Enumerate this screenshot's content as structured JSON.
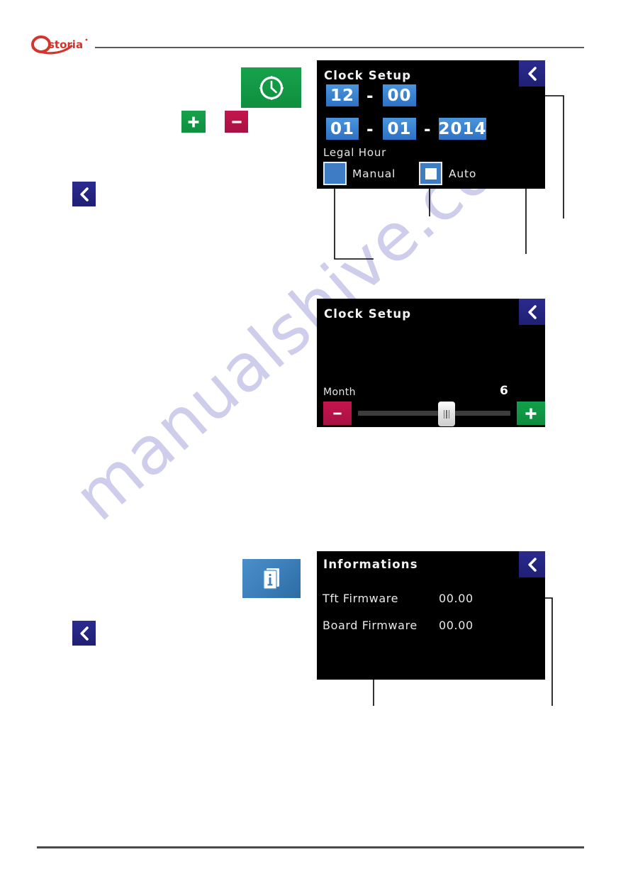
{
  "page": {
    "brand": "astoria",
    "watermark": "manualshive.com"
  },
  "icons": {
    "clock_button": "clock-icon",
    "plus_button": "plus-icon",
    "minus_button": "minus-icon",
    "info_button": "info-document-icon",
    "back_button": "chevron-left-icon"
  },
  "standalone_buttons": {
    "plus_label": "+",
    "minus_label": "-",
    "nav_back_upper": "<",
    "nav_back_lower": "<"
  },
  "panels": [
    {
      "id": "clock-setup-datetime",
      "title": "Clock Setup",
      "back_label": "<",
      "time": {
        "hours": "12",
        "minutes": "00",
        "separator": "-"
      },
      "date": {
        "day": "01",
        "month": "01",
        "year": "2014",
        "separator": "-"
      },
      "legal_hour": {
        "label": "Legal Hour",
        "options": [
          {
            "label": "Manual",
            "selected": false
          },
          {
            "label": "Auto",
            "selected": true
          }
        ]
      }
    },
    {
      "id": "clock-setup-month",
      "title": "Clock Setup",
      "back_label": "<",
      "slider": {
        "label": "Month",
        "value": "6",
        "minus_label": "-",
        "plus_label": "+",
        "position_percent": 47
      }
    },
    {
      "id": "informations",
      "title": "Informations",
      "back_label": "<",
      "rows": [
        {
          "label": "Tft Firmware",
          "value": "00.00"
        },
        {
          "label": "Board Firmware",
          "value": "00.00"
        }
      ]
    }
  ],
  "colors": {
    "brand_red": "#d6342b",
    "panel_bg": "#000000",
    "accent_blue": "#3d81cc",
    "back_navy": "#25258a",
    "green": "#12a04a",
    "crimson": "#c4154f",
    "rule_gray": "#5a5a5a",
    "watermark": "#c3c3e8"
  }
}
